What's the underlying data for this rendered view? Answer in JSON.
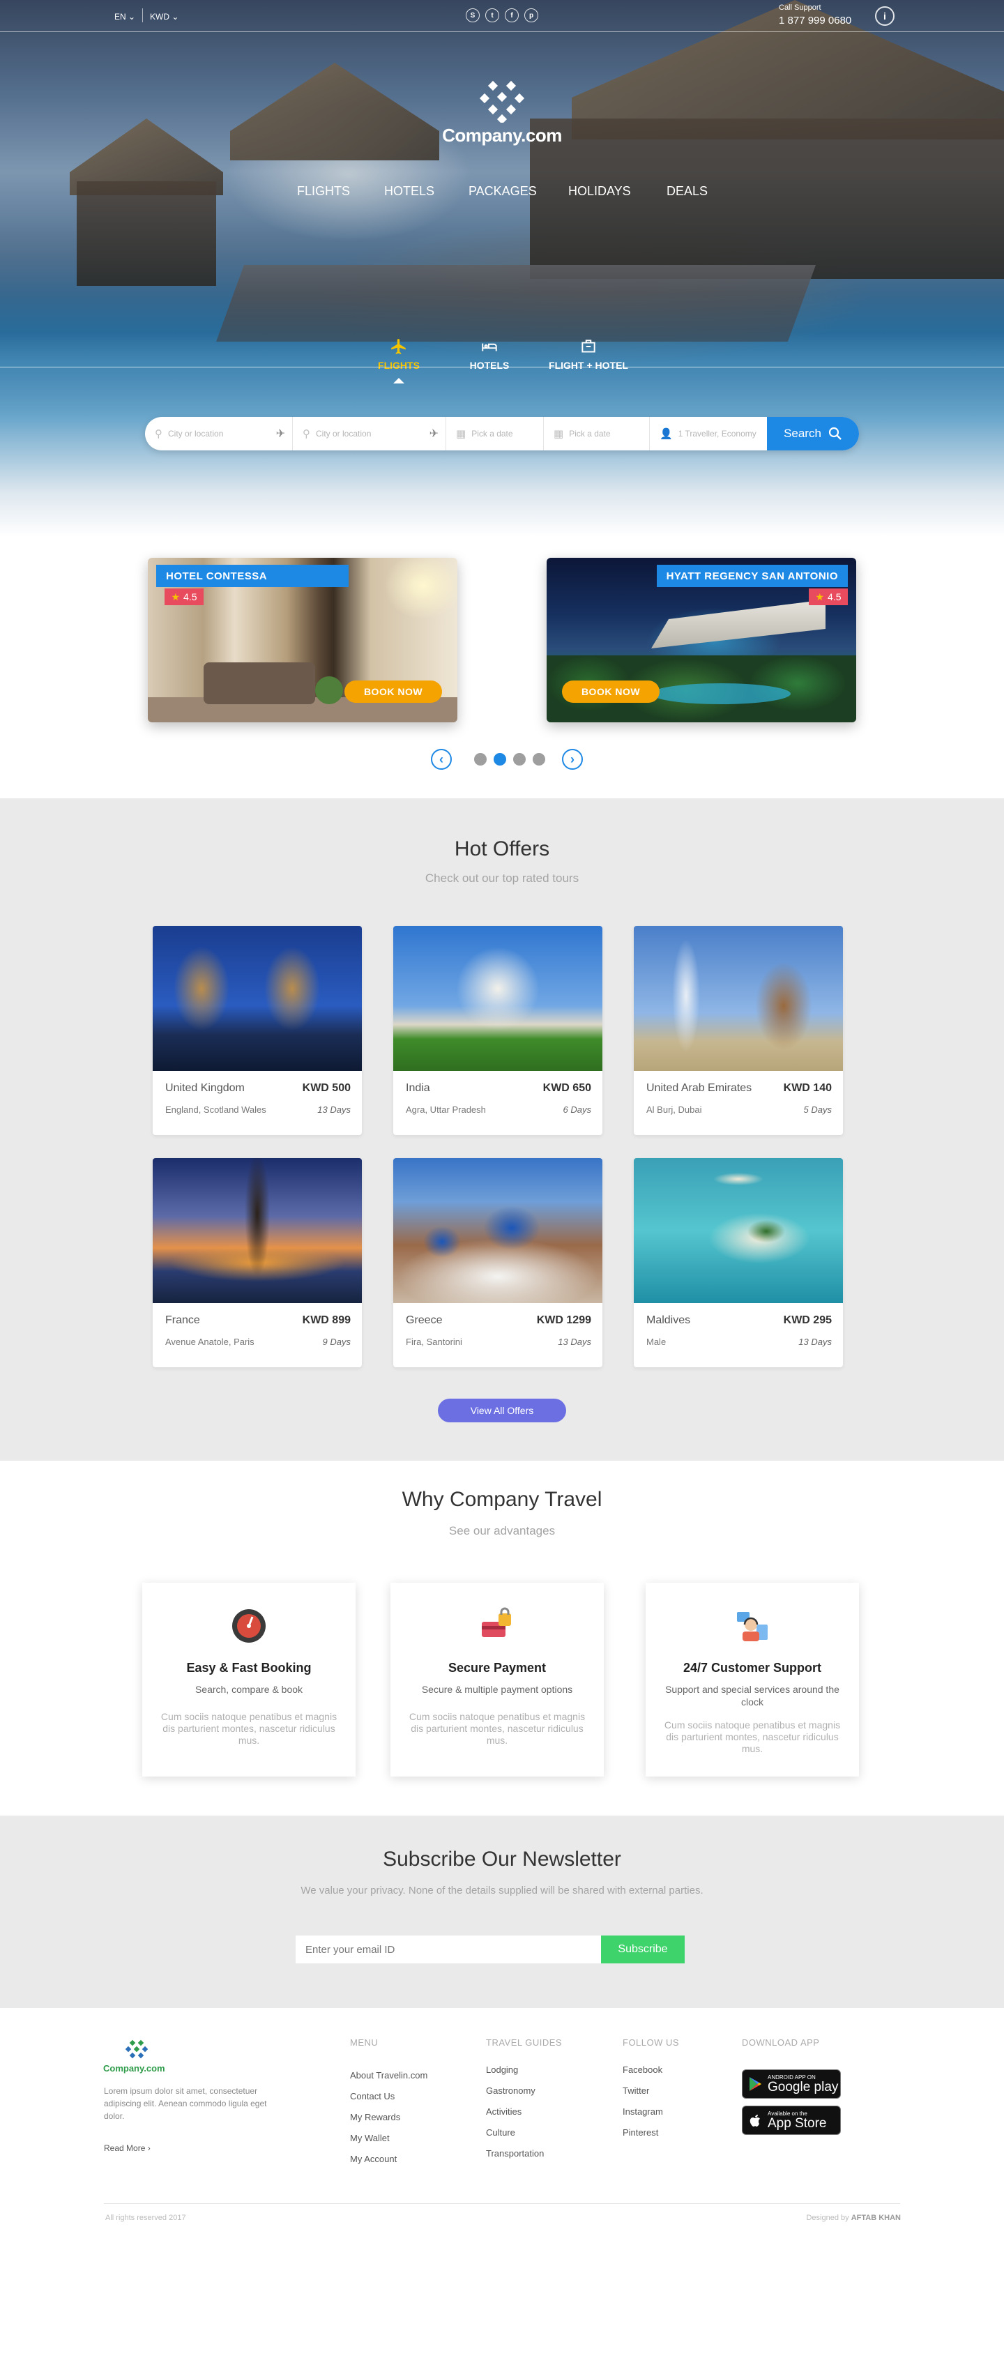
{
  "topbar": {
    "language": "EN",
    "currency": "KWD",
    "support_label": "Call Support",
    "support_number": "1 877 999 0680",
    "social_icons": [
      "skype-icon",
      "twitter-icon",
      "facebook-icon",
      "pinterest-icon"
    ]
  },
  "brand": {
    "name": "Company.com"
  },
  "nav": [
    "FLIGHTS",
    "HOTELS",
    "PACKAGES",
    "HOLIDAYS",
    "DEALS"
  ],
  "search_tabs": [
    {
      "label": "FLIGHTS",
      "icon": "airplane-icon",
      "active": true
    },
    {
      "label": "HOTELS",
      "icon": "bed-icon",
      "active": false
    },
    {
      "label": "FLIGHT + HOTEL",
      "icon": "suitcase-icon",
      "active": false
    }
  ],
  "search": {
    "from_placeholder": "City or location",
    "to_placeholder": "City or location",
    "depart_placeholder": "Pick a date",
    "return_placeholder": "Pick a date",
    "travellers_placeholder": "1 Traveller, Economy",
    "button_label": "Search"
  },
  "featured": [
    {
      "name": "HOTEL CONTESSA",
      "rating": "4.5",
      "button": "BOOK NOW"
    },
    {
      "name": "HYATT REGENCY SAN ANTONIO",
      "rating": "4.5",
      "button": "BOOK NOW"
    }
  ],
  "carousel": {
    "dots": 4,
    "active_index": 1
  },
  "hot_offers": {
    "title": "Hot Offers",
    "subtitle": "Check out our top rated tours",
    "items": [
      {
        "country": "United Kingdom",
        "price": "KWD 500",
        "location": "England, Scotland Wales",
        "days": "13 Days"
      },
      {
        "country": "India",
        "price": "KWD 650",
        "location": "Agra, Uttar Pradesh",
        "days": "6 Days"
      },
      {
        "country": "United Arab Emirates",
        "price": "KWD 140",
        "location": "Al Burj, Dubai",
        "days": "5 Days"
      },
      {
        "country": "France",
        "price": "KWD 899",
        "location": "Avenue Anatole, Paris",
        "days": "9 Days"
      },
      {
        "country": "Greece",
        "price": "KWD 1299",
        "location": "Fira, Santorini",
        "days": "13 Days"
      },
      {
        "country": "Maldives",
        "price": "KWD 295",
        "location": "Male",
        "days": "13 Days"
      }
    ],
    "view_all": "View All Offers"
  },
  "why": {
    "title": "Why Company Travel",
    "subtitle": "See our advantages",
    "items": [
      {
        "title": "Easy & Fast Booking",
        "sub": "Search, compare & book",
        "desc": "Cum sociis natoque penatibus et magnis dis parturient montes, nascetur ridiculus mus."
      },
      {
        "title": "Secure Payment",
        "sub": "Secure & multiple payment options",
        "desc": "Cum sociis natoque penatibus et magnis dis parturient montes, nascetur ridiculus mus."
      },
      {
        "title": "24/7 Customer Support",
        "sub": "Support and special services around the clock",
        "desc": "Cum sociis natoque penatibus et magnis dis parturient montes, nascetur ridiculus mus."
      }
    ]
  },
  "newsletter": {
    "title": "Subscribe Our Newsletter",
    "subtitle": "We value your privacy. None of the details supplied will be shared with external  parties.",
    "placeholder": "Enter your email ID",
    "button": "Subscribe"
  },
  "footer": {
    "brand": "Company.com",
    "about": "Lorem ipsum dolor sit amet, consectetuer adipiscing elit. Aenean commodo ligula eget dolor.",
    "read_more": "Read More",
    "menu_title": "MENU",
    "menu": [
      "About Travelin.com",
      "Contact Us",
      "My Rewards",
      "My Wallet",
      "My Account"
    ],
    "guides_title": "TRAVEL GUIDES",
    "guides": [
      "Lodging",
      "Gastronomy",
      "Activities",
      "Culture",
      "Transportation"
    ],
    "follow_title": "FOLLOW US",
    "follow": [
      "Facebook",
      "Twitter",
      "Instagram",
      "Pinterest"
    ],
    "app_title": "DOWNLOAD APP",
    "google_small": "ANDROID APP ON",
    "google_big": "Google play",
    "apple_small": "Available on the",
    "apple_big": "App Store",
    "copyright": "All rights reserved 2017",
    "designed_by": "Designed by",
    "designer": "AFTAB KHAN"
  }
}
